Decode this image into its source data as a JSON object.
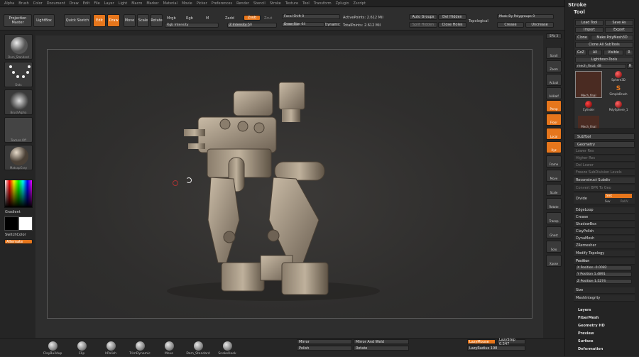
{
  "menu": [
    "Alpha",
    "Brush",
    "Color",
    "Document",
    "Draw",
    "Edit",
    "File",
    "Layer",
    "Light",
    "Macro",
    "Marker",
    "Material",
    "Movie",
    "Picker",
    "Preferences",
    "Render",
    "Stencil",
    "Stroke",
    "Texture",
    "Tool",
    "Transform",
    "Zplugin",
    "Zscript"
  ],
  "toolbar": {
    "projection_master": "Projection Master",
    "lightbox": "LightBox",
    "quick_sketch": "Quick Sketch",
    "edit": "Edit",
    "draw": "Draw",
    "move": "Move",
    "scale": "Scale",
    "rotate": "Rotate",
    "mrgb": "Mrgb",
    "rgb": "Rgb",
    "m": "M",
    "zadd": "Zadd",
    "zsub": "Zsub",
    "zcut": "Zcut",
    "rgb_intensity": "Rgb Intensity",
    "z_intensity": "Z Intensity 50",
    "focal_shift": "Focal Shift 0",
    "draw_size": "Draw Size 64",
    "dynamic": "Dynamic",
    "active_points": "ActivePoints: 2.612 Mil",
    "total_points": "TotalPoints: 2.612 Mil",
    "auto_groups": "Auto Groups",
    "del_hidden": "Del Hidden",
    "split_hidden": "Split Hidden",
    "close_holes": "Close Holes",
    "topological": "Topological",
    "mask_by_polygroups": "Mask By Polygroups 0",
    "groups_split": "Groups Split",
    "crease": "Crease",
    "uncrease": "Uncrease"
  },
  "left_shelf": {
    "brush_label": "Dam_Standard",
    "stroke_label": "Dots",
    "alpha_label": "BrushAlpha",
    "texture_label": "Texture Off",
    "material_label": "MatcapGray",
    "gradient": "Gradient",
    "switch_color": "SwitchColor",
    "alternate": "Alternate"
  },
  "right_shelf": [
    "SPix 3",
    "Scroll",
    "Zoom",
    "Actual",
    "AAHalf",
    "Persp",
    "Floor",
    "Local",
    "Xyz",
    "Frame",
    "Move",
    "Scale",
    "Rotate",
    "Transp",
    "Ghost",
    "Solo",
    "Xpose"
  ],
  "bottom_brushes": [
    "ClayBuildup",
    "Clip",
    "hPolish",
    "TrimDynamic",
    "Move",
    "Dam_Standard",
    "SnakeHook"
  ],
  "bottom_controls": {
    "mirror": "Mirror",
    "mirror_weld": "Mirror And Weld",
    "polish": "Polish",
    "rotate": "Rotate",
    "lazymouse": "LazyMouse",
    "lazystep": "LazyStep 0.547",
    "lazyradius": "LazyRadius 198"
  },
  "tray": {
    "stroke": "Stroke",
    "tool": "Tool",
    "load_tool": "Load Tool",
    "save_as": "Save As",
    "import": "Import",
    "export": "Export",
    "clone": "Clone",
    "make_polymesh": "Make PolyMesh3D",
    "clone_all": "Clone All SubTools",
    "goz": "GoZ",
    "all": "All",
    "visible": "Visible",
    "r": "R",
    "lightbox_tools": "Lightbox>Tools",
    "mech_name": "mech_final: 48",
    "thumbs": [
      "Mech_final",
      "Sphere3D",
      "SimpleBrush",
      "Cylinder",
      "PolySphere_1",
      "Mech_final"
    ],
    "subtool": "SubTool",
    "geometry": "Geometry",
    "geometry_items": [
      "Lower Res",
      "Higher Res",
      "Del Lower",
      "Del Higher",
      "Freeze SubDivision Levels"
    ],
    "reconstruct_subdiv": "Reconstruct Subdiv",
    "convert_bpr": "Convert BPR To Geo",
    "divide": "Divide",
    "smt": "Smt",
    "suv": "Suv",
    "reuv": "ReUV",
    "sections": [
      "EdgeLoop",
      "Crease",
      "ShadowBox",
      "ClayPolish",
      "DynaMesh",
      "ZRemesher",
      "Modify Topology"
    ],
    "position": "Position",
    "x_position": "X Position -0.0082",
    "y_position": "Y Position 1.4891",
    "z_position": "Z Position 1.5274",
    "size": "Size",
    "meshintegrity": "MeshIntegrity",
    "footer": [
      "Layers",
      "FiberMesh",
      "Geometry HD",
      "Preview",
      "Surface",
      "Deformation"
    ]
  },
  "colors": {
    "accent": "#e6761c",
    "panel": "#2e2e2e",
    "dark": "#242424"
  }
}
